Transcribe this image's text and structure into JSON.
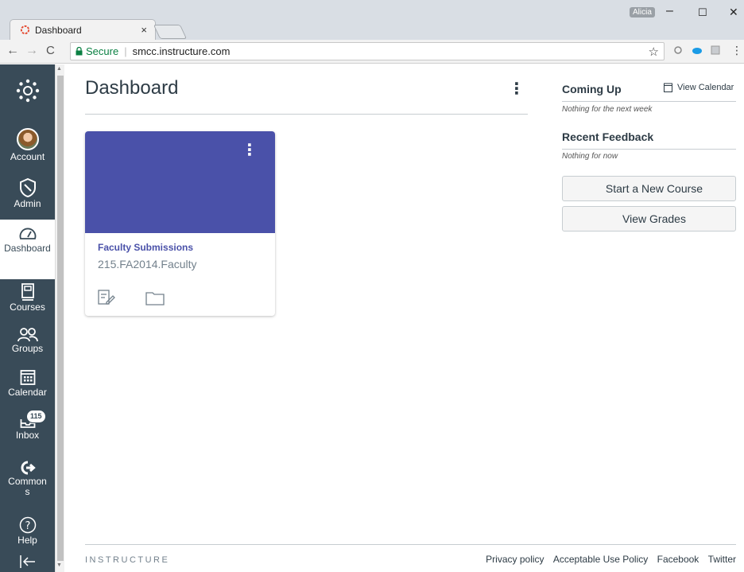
{
  "browser": {
    "tab_title": "Dashboard",
    "tab_close": "×",
    "profile_name": "Alicia",
    "window_controls": {
      "minimize": "–",
      "maximize": "☐",
      "close": "✕"
    },
    "nav": {
      "back": "←",
      "forward": "→",
      "reload": "C"
    },
    "secure_label": "Secure",
    "url": "smcc.instructure.com",
    "star": "☆",
    "menu": "⋮"
  },
  "global_nav": {
    "items": [
      {
        "label": "Account",
        "icon": "avatar"
      },
      {
        "label": "Admin",
        "icon": "shield-icon"
      },
      {
        "label": "Dashboard",
        "icon": "speedometer-icon",
        "active": true
      },
      {
        "label": "Courses",
        "icon": "book-icon"
      },
      {
        "label": "Groups",
        "icon": "users-icon"
      },
      {
        "label": "Calendar",
        "icon": "calendar-icon"
      },
      {
        "label": "Inbox",
        "icon": "inbox-icon",
        "badge": "115"
      },
      {
        "label": "Commons",
        "icon": "commons-icon"
      },
      {
        "label": "Help",
        "icon": "help-icon"
      }
    ],
    "label_account": "Account",
    "label_admin": "Admin",
    "label_dashboard": "Dashboard",
    "label_courses": "Courses",
    "label_groups": "Groups",
    "label_calendar": "Calendar",
    "label_inbox": "Inbox",
    "inbox_badge": "115",
    "label_commons": "Commons",
    "label_help": "Help"
  },
  "main": {
    "title": "Dashboard",
    "options_icon": "⋮",
    "card": {
      "name": "Faculty Submissions",
      "code": "215.FA2014.Faculty",
      "hero_color": "#4a51a9",
      "options_icon": "⋮"
    }
  },
  "sidebar": {
    "coming_up": "Coming Up",
    "view_calendar": "View Calendar",
    "coming_up_empty": "Nothing for the next week",
    "recent_feedback": "Recent Feedback",
    "recent_feedback_empty": "Nothing for now",
    "start_course": "Start a New Course",
    "view_grades": "View Grades"
  },
  "footer": {
    "brand": "INSTRUCTURE",
    "links": [
      "Privacy policy",
      "Acceptable Use Policy",
      "Facebook",
      "Twitter"
    ]
  },
  "colors": {
    "nav_bg": "#394b58",
    "card_hero": "#4a51a9",
    "text": "#2d3b45"
  }
}
